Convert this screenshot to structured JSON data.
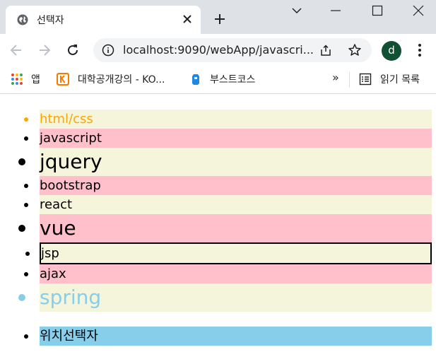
{
  "browser": {
    "tab_title": "선택자",
    "url": "localhost:9090/webApp/javascri...",
    "profile_initial": "d"
  },
  "bookmarks": {
    "apps_label": "앱",
    "item1_label": "대학공개강의 - KO...",
    "item2_label": "부스트코스",
    "overflow_label": "»",
    "reading_list_label": "읽기 목록"
  },
  "page": {
    "items": [
      {
        "label": "html/css",
        "bg": "#f5f5dc",
        "color": "#ffa500"
      },
      {
        "label": "javascript",
        "bg": "#ffc0cb",
        "color": "#000000"
      },
      {
        "label": "jquery",
        "bg": "#f5f5dc",
        "color": "#000000"
      },
      {
        "label": "bootstrap",
        "bg": "#ffc0cb",
        "color": "#000000"
      },
      {
        "label": "react",
        "bg": "#f5f5dc",
        "color": "#000000"
      },
      {
        "label": "vue",
        "bg": "#ffc0cb",
        "color": "#000000"
      },
      {
        "label": "jsp",
        "bg": "#f5f5dc",
        "color": "#000000"
      },
      {
        "label": "ajax",
        "bg": "#ffc0cb",
        "color": "#000000"
      },
      {
        "label": "spring",
        "bg": "#f5f5dc",
        "color": "#87ceeb"
      }
    ],
    "second_list": [
      {
        "label": "위치선택자",
        "bg": "#87ceeb",
        "color": "#000000"
      }
    ]
  },
  "colors": {
    "tabstrip": "#dee1e6",
    "omnibox": "#f1f3f4",
    "beige": "#f5f5dc",
    "pink": "#ffc0cb",
    "skyblue": "#87ceeb",
    "orange": "#ffa500"
  }
}
